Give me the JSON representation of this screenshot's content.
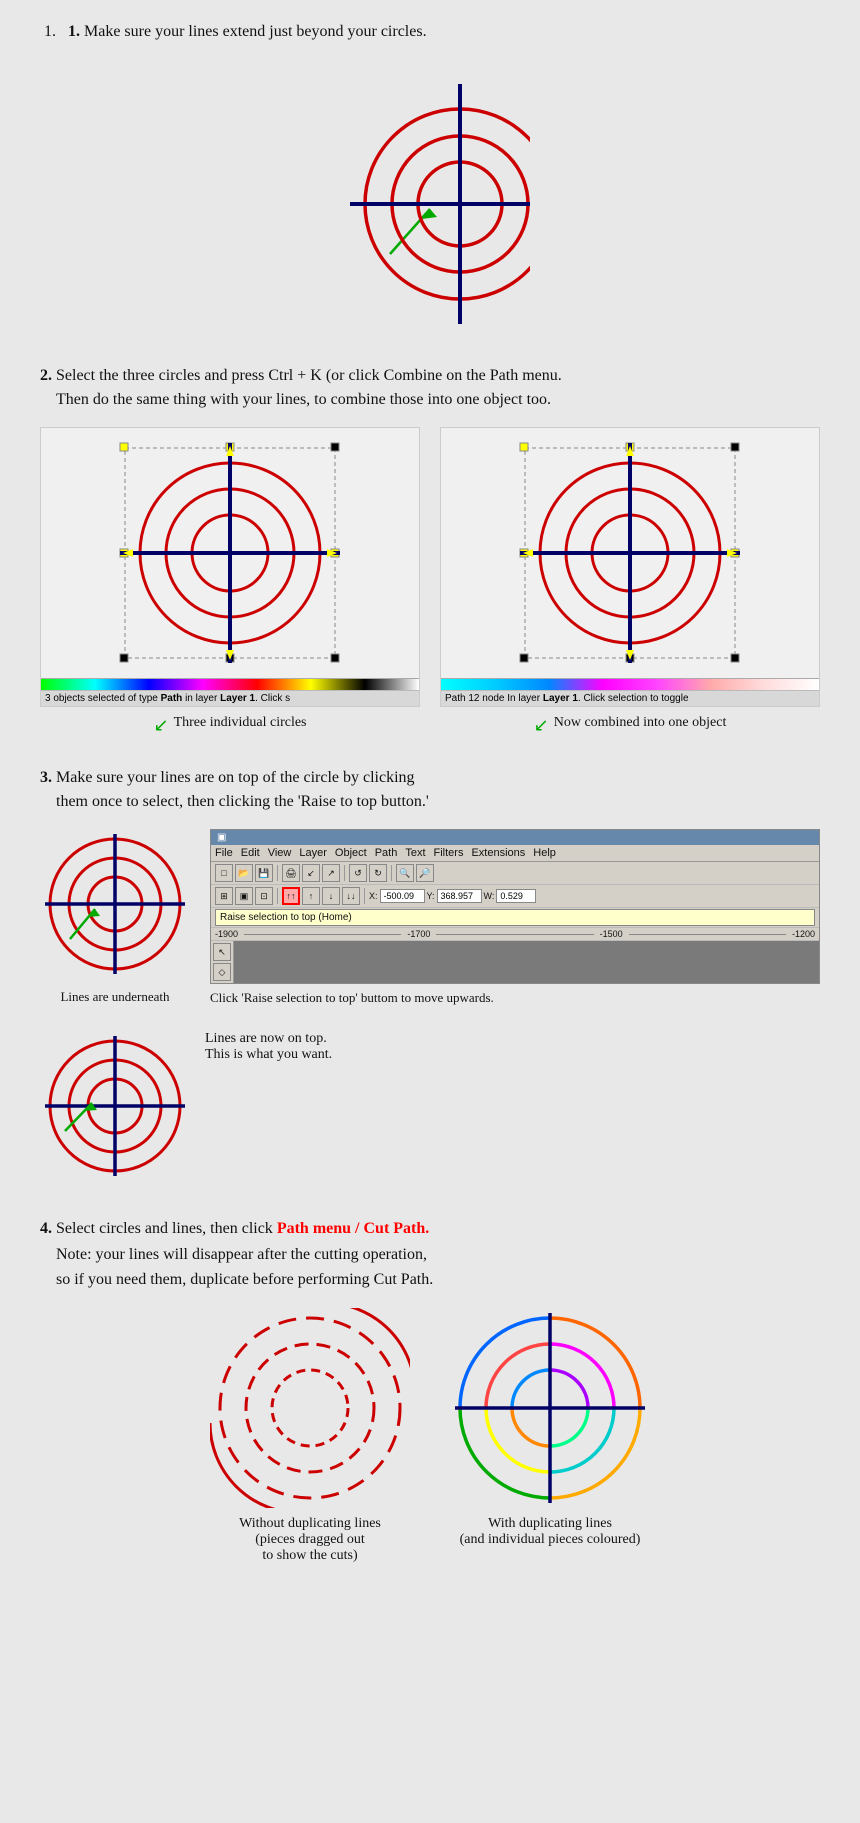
{
  "steps": [
    {
      "number": "1.",
      "title": "Make sure your lines extend just beyond your circles."
    },
    {
      "number": "2.",
      "title": "Select the three circles and press Ctrl + K (or click Combine on the Path menu.\nThen do the same thing with your lines, to combine those into one object too.",
      "status_left": "3 objects selected of type ",
      "status_left_bold1": "Path",
      "status_left_rest": " in layer ",
      "status_left_bold2": "Layer 1",
      "status_left_end": ". Click s",
      "status_right": "Path 12 node In layer ",
      "status_right_bold1": "Layer 1",
      "status_right_end": ". Click selection to toggle",
      "caption_left": "Three individual circles",
      "caption_right": "Now combined into one object"
    },
    {
      "number": "3.",
      "title1": "Make sure your lines are on top of the circle by clicking",
      "title2": "them once to select, then clicking the 'Raise to top button.'",
      "caption_lines_under": "Lines are underneath",
      "caption_lines_top1": "Lines are now on top.",
      "caption_lines_top2": "This is what you want.",
      "inkscape_menu": [
        "File",
        "Edit",
        "View",
        "Layer",
        "Object",
        "Path",
        "Text",
        "Filters",
        "Extensions",
        "Help"
      ],
      "raise_tooltip": "Raise selection to top (Home)",
      "coord_x": "-500.09",
      "coord_y": "368.957",
      "coord_w": "0.529",
      "ruler_vals": [
        "-1900",
        "-1700",
        "-1500",
        "-1200"
      ],
      "click_caption": "Click 'Raise selection to top' buttom to move upwards."
    },
    {
      "number": "4.",
      "title1": "Select circles and lines, then click ",
      "title_red": "Path menu / Cut Path.",
      "title2": "Note: your lines will disappear after the cutting operation,",
      "title3": "so if you need them, duplicate before performing Cut Path.",
      "caption_left1": "Without duplicating lines",
      "caption_left2": "(pieces dragged out",
      "caption_left3": "to show the cuts)",
      "caption_right1": "With duplicating lines",
      "caption_right2": "(and individual pieces coloured)"
    }
  ]
}
